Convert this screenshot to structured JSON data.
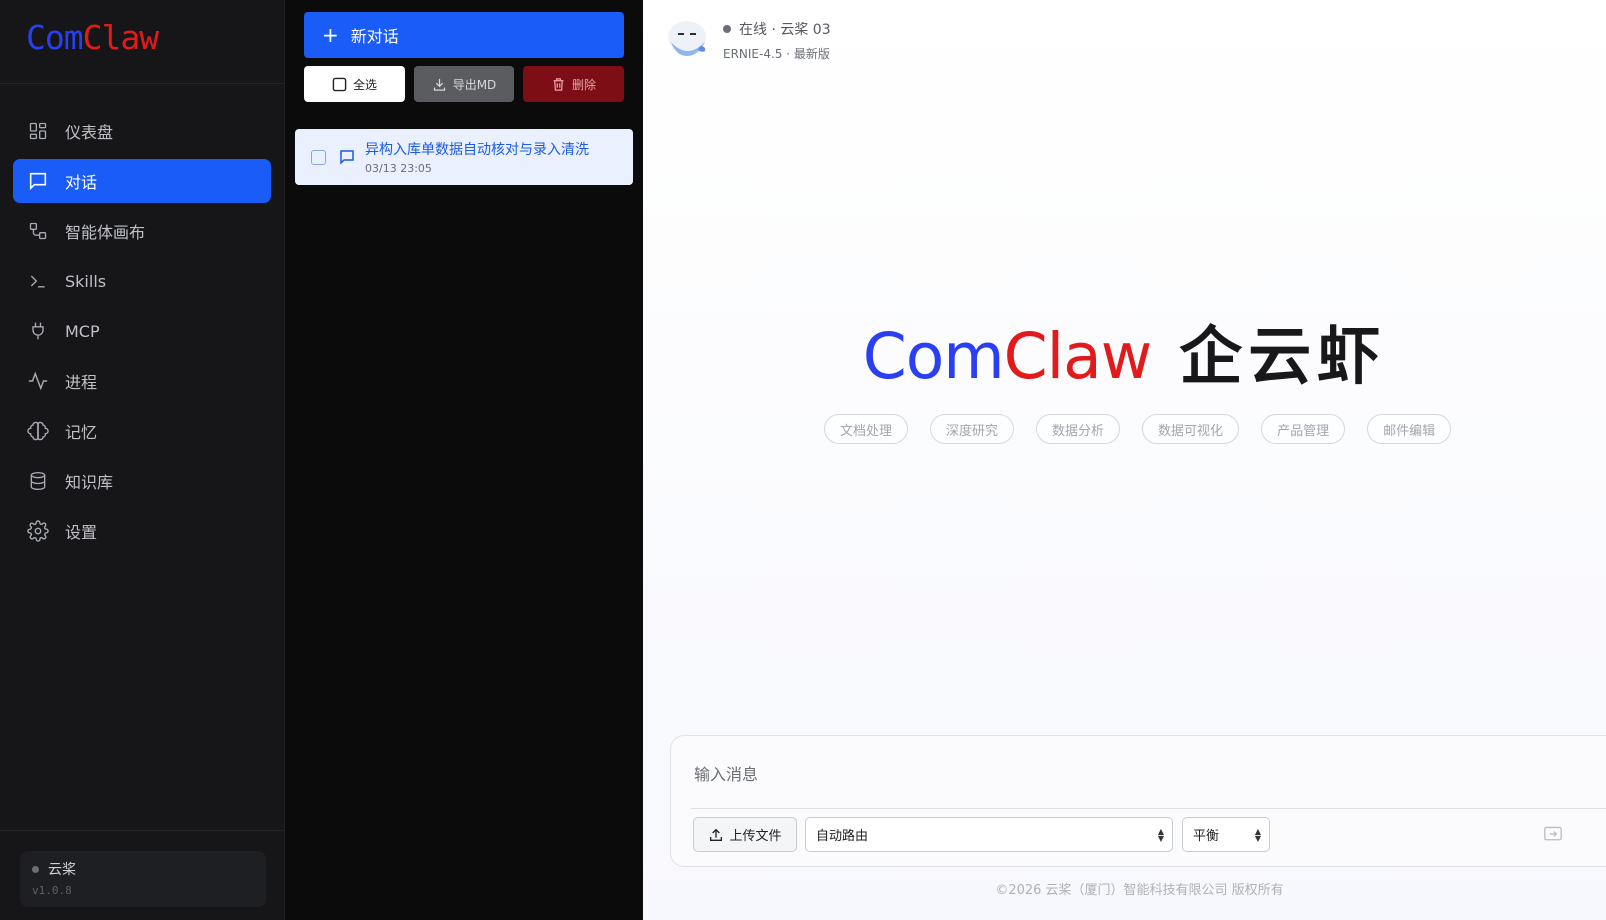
{
  "brand": {
    "logo_part1": "Com",
    "logo_part2": "Claw"
  },
  "sidebar": {
    "items": [
      {
        "label": "仪表盘",
        "icon": "dashboard-icon"
      },
      {
        "label": "对话",
        "icon": "chat-icon",
        "active": true
      },
      {
        "label": "智能体画布",
        "icon": "workflow-icon"
      },
      {
        "label": "Skills",
        "icon": "terminal-icon"
      },
      {
        "label": "MCP",
        "icon": "plug-icon"
      },
      {
        "label": "进程",
        "icon": "activity-icon"
      },
      {
        "label": "记忆",
        "icon": "brain-icon"
      },
      {
        "label": "知识库",
        "icon": "database-icon"
      },
      {
        "label": "设置",
        "icon": "gear-icon"
      }
    ],
    "footer": {
      "name": "云桨",
      "version": "v1.0.8"
    }
  },
  "conversations": {
    "new_label": "新对话",
    "select_all_label": "全选",
    "export_label": "导出MD",
    "delete_label": "删除",
    "items": [
      {
        "title": "异构入库单数据自动核对与录入清洗",
        "time": "03/13 23:05"
      }
    ]
  },
  "header": {
    "status": "在线 · 云桨 03",
    "model": "ERNIE-4.5 · 最新版"
  },
  "hero": {
    "part1": "Com",
    "part2": "Claw",
    "part3": "企云虾"
  },
  "suggestions": [
    "文档处理",
    "深度研究",
    "数据分析",
    "数据可视化",
    "产品管理",
    "邮件编辑"
  ],
  "composer": {
    "placeholder": "输入消息",
    "upload_label": "上传文件",
    "model_value": "自动路由",
    "mode_value": "平衡"
  },
  "footer": {
    "copyright": "©2026 云桨（厦门）智能科技有限公司 版权所有"
  },
  "colors": {
    "accent": "#1a5cf7",
    "brand_blue": "#2a3ff3",
    "brand_red": "#e21a1a",
    "danger": "#7d0e15"
  }
}
